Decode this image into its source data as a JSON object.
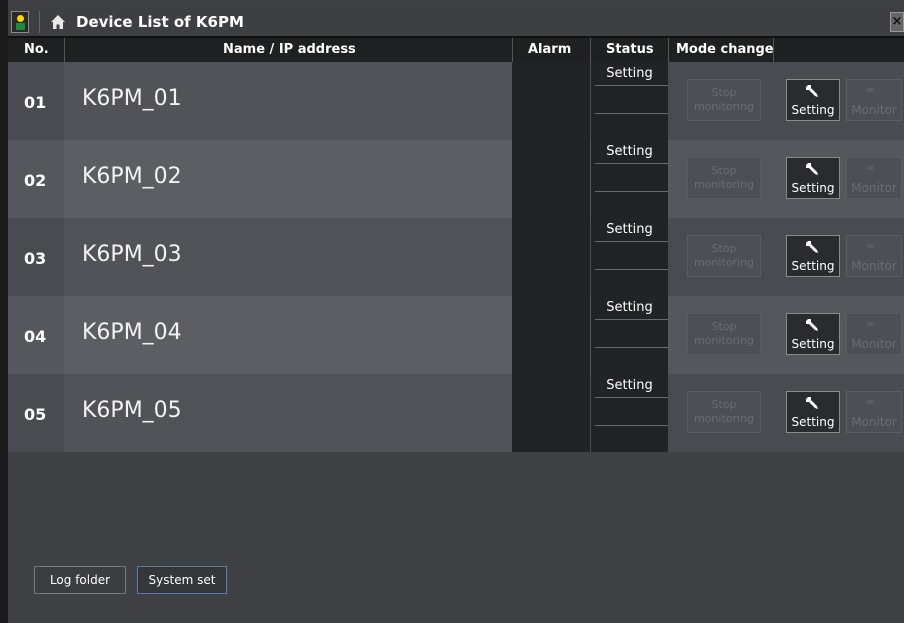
{
  "window": {
    "title": "Device List of K6PM",
    "close_label": "×"
  },
  "table": {
    "headers": {
      "no": "No.",
      "name": "Name / IP address",
      "alarm": "Alarm",
      "status": "Status",
      "mode_change": "Mode change"
    },
    "rows": [
      {
        "no": "01",
        "name": "K6PM_01",
        "status": "Setting",
        "mode_btn": "Stop monitoring",
        "setting_btn": "Setting",
        "monitor_btn": "Monitor"
      },
      {
        "no": "02",
        "name": "K6PM_02",
        "status": "Setting",
        "mode_btn": "Stop monitoring",
        "setting_btn": "Setting",
        "monitor_btn": "Monitor"
      },
      {
        "no": "03",
        "name": "K6PM_03",
        "status": "Setting",
        "mode_btn": "Stop monitoring",
        "setting_btn": "Setting",
        "monitor_btn": "Monitor"
      },
      {
        "no": "04",
        "name": "K6PM_04",
        "status": "Setting",
        "mode_btn": "Stop monitoring",
        "setting_btn": "Setting",
        "monitor_btn": "Monitor"
      },
      {
        "no": "05",
        "name": "K6PM_05",
        "status": "Setting",
        "mode_btn": "Stop monitoring",
        "setting_btn": "Setting",
        "monitor_btn": "Monitor"
      }
    ]
  },
  "footer": {
    "log_folder": "Log folder",
    "system_set": "System set"
  },
  "icons": {
    "app": "app-logo-icon",
    "home": "home-icon",
    "setting": "wrench-icon",
    "monitor": "infinity-icon"
  }
}
